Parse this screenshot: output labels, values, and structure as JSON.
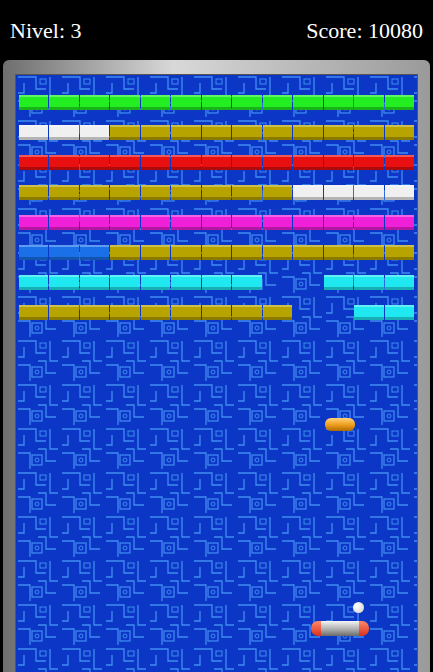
{
  "hud": {
    "level_label": "Nivel: 3",
    "score_label": "Score: 10080"
  },
  "bricks": {
    "rows": [
      {
        "bricks": [
          {
            "broken": false,
            "color": "#22ee22"
          },
          {
            "broken": false,
            "color": "#22ee22"
          },
          {
            "broken": false,
            "color": "#22ee22"
          },
          {
            "broken": false,
            "color": "#22ee22"
          },
          {
            "broken": false,
            "color": "#22ee22"
          },
          {
            "broken": false,
            "color": "#22ee22"
          },
          {
            "broken": false,
            "color": "#22ee22"
          },
          {
            "broken": false,
            "color": "#22ee22"
          },
          {
            "broken": false,
            "color": "#22ee22"
          },
          {
            "broken": false,
            "color": "#22ee22"
          },
          {
            "broken": false,
            "color": "#22ee22"
          },
          {
            "broken": false,
            "color": "#22ee22"
          },
          {
            "broken": false,
            "color": "#22ee22"
          }
        ]
      },
      {
        "bricks": [
          {
            "broken": false,
            "color": "#f0f0f0"
          },
          {
            "broken": false,
            "color": "#f0f0f0"
          },
          {
            "broken": false,
            "color": "#f0f0f0"
          },
          {
            "broken": false,
            "color": "#b8a400"
          },
          {
            "broken": false,
            "color": "#b8a400"
          },
          {
            "broken": false,
            "color": "#b8a400"
          },
          {
            "broken": false,
            "color": "#b8a400"
          },
          {
            "broken": false,
            "color": "#b8a400"
          },
          {
            "broken": false,
            "color": "#b8a400"
          },
          {
            "broken": false,
            "color": "#b8a400"
          },
          {
            "broken": false,
            "color": "#b8a400"
          },
          {
            "broken": false,
            "color": "#b8a400"
          },
          {
            "broken": false,
            "color": "#b8a400"
          }
        ]
      },
      {
        "bricks": [
          {
            "broken": false,
            "color": "#e81010"
          },
          {
            "broken": false,
            "color": "#e81010"
          },
          {
            "broken": false,
            "color": "#e81010"
          },
          {
            "broken": false,
            "color": "#e81010"
          },
          {
            "broken": false,
            "color": "#e81010"
          },
          {
            "broken": false,
            "color": "#e81010"
          },
          {
            "broken": false,
            "color": "#e81010"
          },
          {
            "broken": false,
            "color": "#e81010"
          },
          {
            "broken": false,
            "color": "#e81010"
          },
          {
            "broken": false,
            "color": "#e81010"
          },
          {
            "broken": false,
            "color": "#e81010"
          },
          {
            "broken": false,
            "color": "#e81010"
          },
          {
            "broken": false,
            "color": "#e81010"
          }
        ]
      },
      {
        "bricks": [
          {
            "broken": false,
            "color": "#b8a400"
          },
          {
            "broken": false,
            "color": "#b8a400"
          },
          {
            "broken": false,
            "color": "#b8a400"
          },
          {
            "broken": false,
            "color": "#b8a400"
          },
          {
            "broken": false,
            "color": "#b8a400"
          },
          {
            "broken": false,
            "color": "#b8a400"
          },
          {
            "broken": false,
            "color": "#b8a400"
          },
          {
            "broken": false,
            "color": "#b8a400"
          },
          {
            "broken": false,
            "color": "#b8a400"
          },
          {
            "broken": false,
            "color": "#f0f0f0"
          },
          {
            "broken": false,
            "color": "#f0f0f0"
          },
          {
            "broken": false,
            "color": "#f0f0f0"
          },
          {
            "broken": false,
            "color": "#f0f0f0"
          }
        ]
      },
      {
        "bricks": [
          {
            "broken": false,
            "color": "#f020d8"
          },
          {
            "broken": false,
            "color": "#f020d8"
          },
          {
            "broken": false,
            "color": "#f020d8"
          },
          {
            "broken": false,
            "color": "#f020d8"
          },
          {
            "broken": false,
            "color": "#f020d8"
          },
          {
            "broken": false,
            "color": "#f020d8"
          },
          {
            "broken": false,
            "color": "#f020d8"
          },
          {
            "broken": false,
            "color": "#f020d8"
          },
          {
            "broken": false,
            "color": "#f020d8"
          },
          {
            "broken": false,
            "color": "#f020d8"
          },
          {
            "broken": false,
            "color": "#f020d8"
          },
          {
            "broken": false,
            "color": "#f020d8"
          },
          {
            "broken": false,
            "color": "#f020d8"
          }
        ]
      },
      {
        "bricks": [
          {
            "broken": false,
            "color": "#1a70e8"
          },
          {
            "broken": false,
            "color": "#1a70e8"
          },
          {
            "broken": false,
            "color": "#1a70e8"
          },
          {
            "broken": false,
            "color": "#b8a400"
          },
          {
            "broken": false,
            "color": "#b8a400"
          },
          {
            "broken": false,
            "color": "#b8a400"
          },
          {
            "broken": false,
            "color": "#b8a400"
          },
          {
            "broken": false,
            "color": "#b8a400"
          },
          {
            "broken": false,
            "color": "#b8a400"
          },
          {
            "broken": false,
            "color": "#b8a400"
          },
          {
            "broken": false,
            "color": "#b8a400"
          },
          {
            "broken": false,
            "color": "#b8a400"
          },
          {
            "broken": false,
            "color": "#b8a400"
          }
        ]
      },
      {
        "bricks": [
          {
            "broken": false,
            "color": "#20e8f0"
          },
          {
            "broken": false,
            "color": "#20e8f0"
          },
          {
            "broken": false,
            "color": "#20e8f0"
          },
          {
            "broken": false,
            "color": "#20e8f0"
          },
          {
            "broken": false,
            "color": "#20e8f0"
          },
          {
            "broken": false,
            "color": "#20e8f0"
          },
          {
            "broken": false,
            "color": "#20e8f0"
          },
          {
            "broken": false,
            "color": "#20e8f0"
          },
          {
            "broken": true,
            "color": "#20e8f0"
          },
          {
            "broken": true,
            "color": "#20e8f0"
          },
          {
            "broken": false,
            "color": "#20e8f0"
          },
          {
            "broken": false,
            "color": "#20e8f0"
          },
          {
            "broken": false,
            "color": "#20e8f0"
          }
        ]
      },
      {
        "bricks": [
          {
            "broken": false,
            "color": "#b8a400"
          },
          {
            "broken": false,
            "color": "#b8a400"
          },
          {
            "broken": false,
            "color": "#b8a400"
          },
          {
            "broken": false,
            "color": "#b8a400"
          },
          {
            "broken": false,
            "color": "#b8a400"
          },
          {
            "broken": false,
            "color": "#b8a400"
          },
          {
            "broken": false,
            "color": "#b8a400"
          },
          {
            "broken": false,
            "color": "#b8a400"
          },
          {
            "broken": false,
            "color": "#b8a400"
          },
          {
            "broken": true,
            "color": "#b8a400"
          },
          {
            "broken": true,
            "color": "#b8a400"
          },
          {
            "broken": false,
            "color": "#20e8f0"
          },
          {
            "broken": false,
            "color": "#20e8f0"
          }
        ]
      }
    ]
  }
}
